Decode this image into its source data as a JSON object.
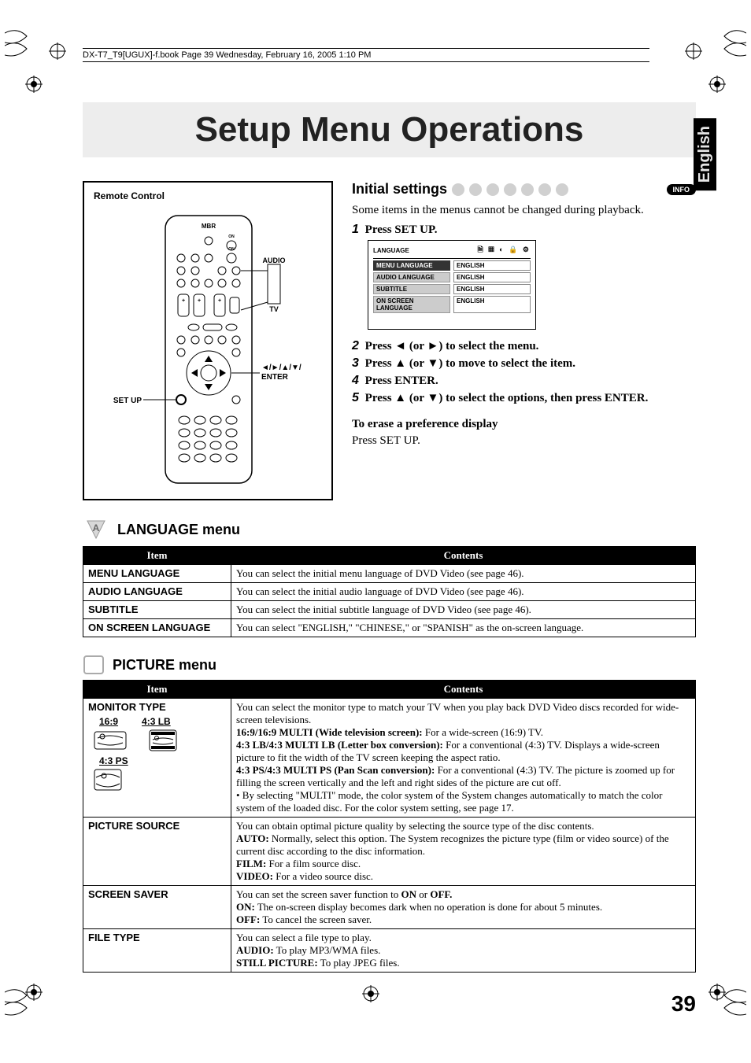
{
  "book_header": "DX-T7_T9[UGUX]-f.book  Page 39  Wednesday, February 16, 2005  1:10 PM",
  "title": "Setup Menu Operations",
  "language_tab": "English",
  "remote": {
    "caption": "Remote Control",
    "label_audio": "AUDIO",
    "label_tv": "TV",
    "label_setup": "SET UP",
    "label_nav": "◄/►/▲/▼/",
    "label_enter": "ENTER"
  },
  "initial_settings": {
    "heading": "Initial settings",
    "info_badge": "INFO",
    "note": "Some items in the menus cannot be changed during playback.",
    "steps": [
      {
        "n": "1",
        "text": "Press SET UP."
      },
      {
        "n": "2",
        "text": "Press ◄ (or ►) to select the menu."
      },
      {
        "n": "3",
        "text": "Press ▲ (or ▼) to move to select the item."
      },
      {
        "n": "4",
        "text": "Press ENTER."
      },
      {
        "n": "5",
        "text": "Press ▲ (or ▼) to select the options, then press ENTER."
      }
    ],
    "osd": {
      "title": "LANGUAGE",
      "rows": [
        {
          "k": "MENU LANGUAGE",
          "v": "ENGLISH"
        },
        {
          "k": "AUDIO LANGUAGE",
          "v": "ENGLISH"
        },
        {
          "k": "SUBTITLE",
          "v": "ENGLISH"
        },
        {
          "k": "ON SCREEN LANGUAGE",
          "v": "ENGLISH"
        }
      ]
    },
    "erase_heading": "To erase a preference display",
    "erase_body": "Press SET UP."
  },
  "language_menu": {
    "heading": "LANGUAGE menu",
    "columns": [
      "Item",
      "Contents"
    ],
    "rows": [
      {
        "item": "MENU LANGUAGE",
        "contents": "You can select the initial menu language of DVD Video (see page 46)."
      },
      {
        "item": "AUDIO LANGUAGE",
        "contents": "You can select the initial audio language of DVD Video (see page 46)."
      },
      {
        "item": "SUBTITLE",
        "contents": "You can select the initial subtitle language of DVD Video (see page 46)."
      },
      {
        "item": "ON SCREEN LANGUAGE",
        "contents": "You can select \"ENGLISH,\" \"CHINESE,\" or \"SPANISH\" as the on-screen language."
      }
    ]
  },
  "picture_menu": {
    "heading": "PICTURE menu",
    "columns": [
      "Item",
      "Contents"
    ],
    "subitems": {
      "a": "16:9",
      "b": "4:3 LB",
      "c": "4:3 PS"
    },
    "rows": [
      {
        "item": "MONITOR TYPE",
        "contents_html": "You can select the monitor type to match your TV when you play back DVD Video discs recorded for wide-screen televisions.<br><b>16:9/16:9 MULTI (Wide television screen):</b> For a wide-screen (16:9) TV.<br><b>4:3 LB/4:3 MULTI LB (Letter box conversion):</b> For a conventional (4:3) TV. Displays a wide-screen picture to fit the width of the TV screen keeping the aspect ratio.<br><b>4:3 PS/4:3 MULTI PS (Pan Scan conversion):</b> For a conventional (4:3) TV. The picture is zoomed up for filling the screen vertically and the left and right sides of the picture are cut off.<br>• By selecting \"MULTI\" mode, the color system of the System changes automatically to match the color system of the loaded disc. For the color system setting, see page 17."
      },
      {
        "item": "PICTURE SOURCE",
        "contents_html": "You can obtain optimal picture quality by selecting the source type of the disc contents.<br><b>AUTO:</b> Normally, select this option. The System recognizes the picture type (film or video source) of the current disc according to the disc information.<br><b>FILM:</b> For a film source disc.<br><b>VIDEO:</b> For a video source disc."
      },
      {
        "item": "SCREEN SAVER",
        "contents_html": "You can set the screen saver function to <b>ON</b> or <b>OFF.</b><br><b>ON:</b> The on-screen display becomes dark when no operation is done for about 5 minutes.<br><b>OFF:</b> To cancel the screen saver."
      },
      {
        "item": "FILE TYPE",
        "contents_html": "You can select a file type to play.<br><b>AUDIO:</b> To play MP3/WMA files.<br><b>STILL PICTURE:</b> To play JPEG files."
      }
    ]
  },
  "page_number": "39"
}
